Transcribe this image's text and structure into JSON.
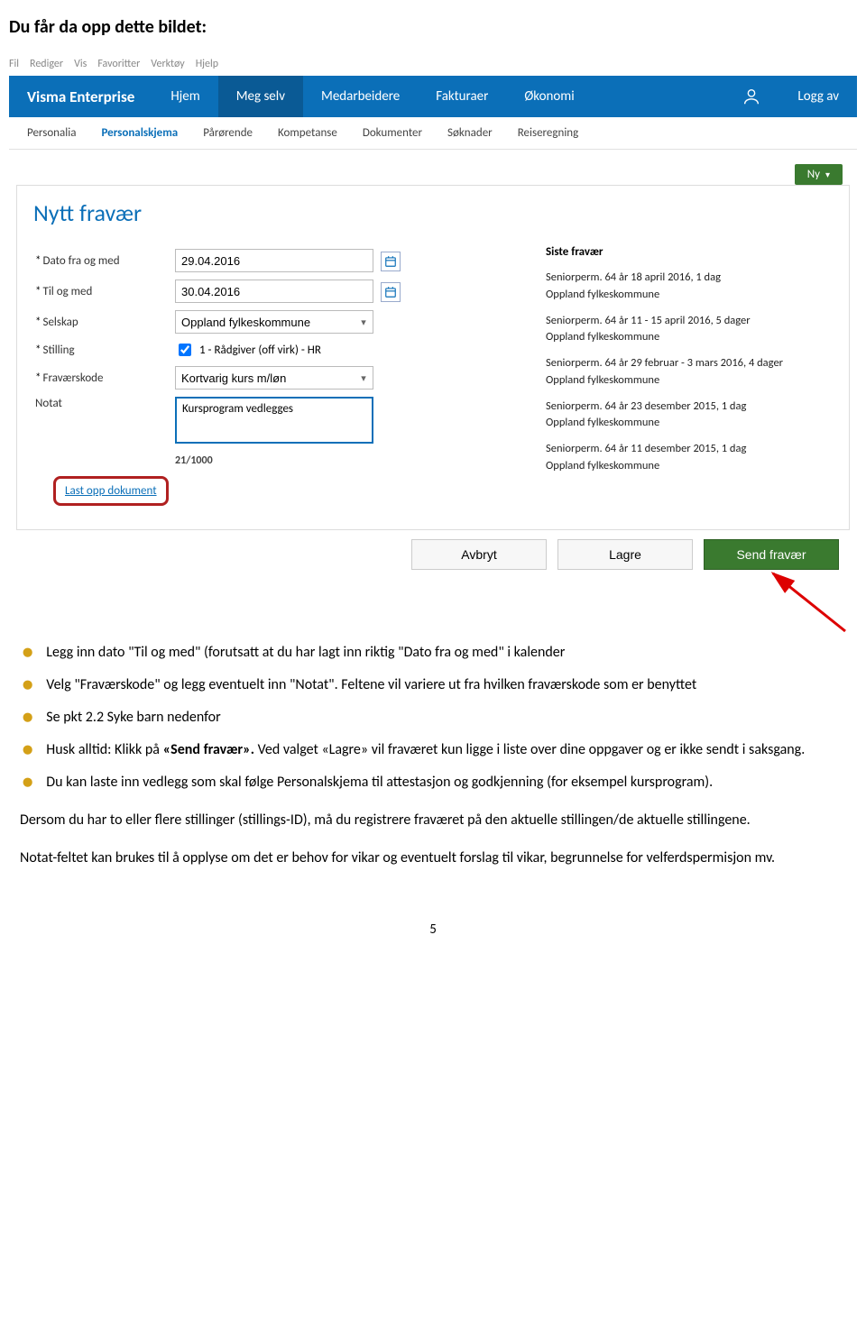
{
  "doc": {
    "intro": "Du får da opp dette bildet:",
    "page_num": "5"
  },
  "app_menu": [
    "Fil",
    "Rediger",
    "Vis",
    "Favoritter",
    "Verktøy",
    "Hjelp"
  ],
  "main_nav": {
    "brand": "Visma Enterprise",
    "tabs": [
      "Hjem",
      "Meg selv",
      "Medarbeidere",
      "Fakturaer",
      "Økonomi"
    ],
    "active": "Meg selv",
    "log_off": "Logg av"
  },
  "sub_nav": {
    "items": [
      "Personalia",
      "Personalskjema",
      "Pårørende",
      "Kompetanse",
      "Dokumenter",
      "Søknader",
      "Reiseregning"
    ],
    "active": "Personalskjema"
  },
  "new_button": "Ny",
  "panel": {
    "title": "Nytt fravær",
    "fields": {
      "date_from_label": "Dato fra og med",
      "date_from_value": "29.04.2016",
      "date_to_label": "Til og med",
      "date_to_value": "30.04.2016",
      "selskap_label": "Selskap",
      "selskap_value": "Oppland fylkeskommune",
      "stilling_label": "Stilling",
      "stilling_value": "1 - Rådgiver (off virk) - HR",
      "fravkode_label": "Fraværskode",
      "fravkode_value": "Kortvarig kurs m/løn",
      "notat_label": "Notat",
      "notat_value": "Kursprogram vedlegges",
      "charcount": "21/1000",
      "upload_label": "Last opp dokument"
    },
    "siste": {
      "title": "Siste fravær",
      "items": [
        {
          "line1": "Seniorperm. 64 år 18 april 2016, 1 dag",
          "line2": "Oppland fylkeskommune"
        },
        {
          "line1": "Seniorperm. 64 år 11 - 15 april 2016, 5 dager",
          "line2": "Oppland fylkeskommune"
        },
        {
          "line1": "Seniorperm. 64 år 29 februar - 3 mars 2016, 4 dager",
          "line2": "Oppland fylkeskommune"
        },
        {
          "line1": "Seniorperm. 64 år 23 desember 2015, 1 dag",
          "line2": "Oppland fylkeskommune"
        },
        {
          "line1": "Seniorperm. 64 år 11 desember 2015, 1 dag",
          "line2": "Oppland fylkeskommune"
        }
      ]
    },
    "buttons": {
      "cancel": "Avbryt",
      "save": "Lagre",
      "send": "Send fravær"
    }
  },
  "bullets": [
    {
      "text_pre": "Legg inn dato \"Til og med\" (forutsatt at du har lagt inn riktig \"Dato fra og med\" i kalender"
    },
    {
      "text_pre": "Velg \"Fraværskode\" og legg eventuelt inn \"Notat\". Feltene vil variere ut fra hvilken fraværskode som er benyttet"
    },
    {
      "text_pre": "Se pkt 2.2 Syke barn nedenfor"
    },
    {
      "text_pre": "Husk alltid: Klikk på ",
      "bold": "«Send fravær». ",
      "text_post": "Ved valget «Lagre» vil fraværet kun ligge i liste over dine oppgaver og er ikke sendt i saksgang."
    },
    {
      "text_pre": "Du kan laste inn vedlegg som skal følge Personalskjema til attestasjon og godkjenning (for eksempel kursprogram)."
    }
  ],
  "para1": "Dersom du har to eller flere stillinger (stillings-ID), må du registrere fraværet på den aktuelle stillingen/de aktuelle stillingene.",
  "para2": "Notat-feltet kan brukes til å opplyse om det er behov for vikar og eventuelt forslag til vikar, begrunnelse for velferdspermisjon mv."
}
